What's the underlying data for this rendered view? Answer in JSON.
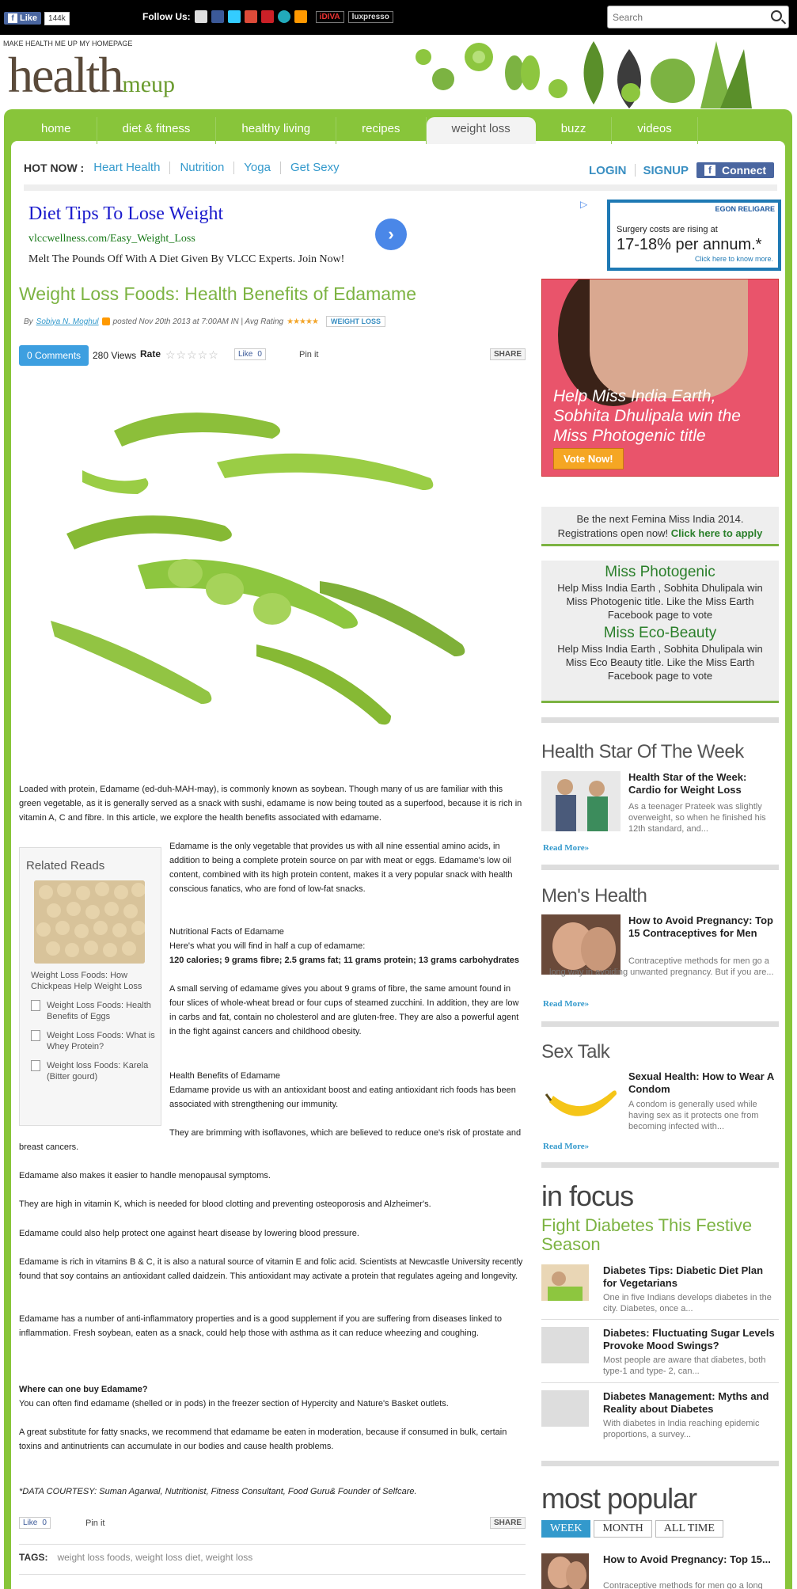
{
  "topbar": {
    "fb_like": "Like",
    "fb_count": "144k",
    "follow_label": "Follow Us:",
    "partner1": "iDIVA",
    "partner2": "luxpresso",
    "search_placeholder": "Search"
  },
  "header": {
    "make_home": "MAKE HEALTH ME UP MY HOMEPAGE",
    "logo_main": "health",
    "logo_sub": "meup"
  },
  "nav": [
    "home",
    "diet & fitness",
    "healthy living",
    "recipes",
    "weight loss",
    "buzz",
    "videos"
  ],
  "hotnow": {
    "label": "HOT NOW :",
    "links": [
      "Heart Health",
      "Nutrition",
      "Yoga",
      "Get Sexy"
    ]
  },
  "auth": {
    "login": "LOGIN",
    "signup": "SIGNUP",
    "connect": "Connect"
  },
  "ad": {
    "title": "Diet Tips To Lose Weight",
    "url": "vlccwellness.com/Easy_Weight_Loss",
    "desc": "Melt The Pounds Off With A Diet Given By VLCC Experts. Join Now!",
    "banner_brand": "EGON RELIGARE",
    "banner_line1": "Surgery costs are rising at",
    "banner_line2": "17-18% per annum.*",
    "banner_line3": "Click here to know more."
  },
  "article": {
    "title": "Weight Loss Foods: Health Benefits of Edamame",
    "by": "By",
    "author": "Sobiya N. Moghul",
    "posted": "posted Nov 20th 2013 at 7:00AM IN | Avg Rating",
    "tag": "WEIGHT LOSS",
    "comments": "0 Comments",
    "views": "280 Views",
    "rate": "Rate",
    "like": "Like",
    "like_count": "0",
    "pinit": "Pin it",
    "share": "SHARE",
    "p1": "Loaded with protein, Edamame (ed-duh-MAH-may), is commonly known as soybean. Though many of us are familiar with this green vegetable, as it is generally served as a snack with sushi, edamame is now being touted as a superfood, because it is rich in vitamin A, C and fibre. In this article, we explore the health benefits associated with edamame.",
    "p2": "Edamame is the only vegetable that provides us with all nine essential amino acids, in addition to being a complete protein source on par with meat or eggs. Edamame's low oil content, combined with its high protein content, makes it a very popular snack with health conscious fanatics, who are fond of low-fat snacks.",
    "h_nutrition": "Nutritional Facts of Edamame",
    "p3": "Here's what you will find in half a cup of edamame:",
    "p4": "120 calories; 9 grams fibre; 2.5 grams fat; 11 grams protein; 13 grams carbohydrates",
    "p5": "A small serving of edamame gives you about 9 grams of fibre, the same amount found in four slices of whole-wheat bread or four cups of steamed zucchini. In addition, they are low in carbs and fat, contain no cholesterol and are gluten-free. They are also a powerful agent in the fight against cancers and childhood obesity.",
    "h_benefits": "Health Benefits of Edamame",
    "p6": "Edamame provide us with an antioxidant boost and eating antioxidant rich foods has been associated with strengthening our immunity.",
    "p7": "They are brimming with isoflavones, which are believed to reduce one's risk of prostate and breast cancers.",
    "p8": "Edamame also makes it easier to handle menopausal symptoms.",
    "p9": "They are high in vitamin K, which is needed for blood clotting and preventing osteoporosis and Alzheimer's.",
    "p10": "Edamame could also help protect one against heart disease by lowering blood pressure.",
    "p11": "Edamame is rich in vitamins B & C, it is also a natural source of vitamin E and folic acid. Scientists at Newcastle University recently found that soy contains an antioxidant called daidzein. This antioxidant may activate a protein that regulates ageing and longevity.",
    "p12": "Edamame has a number of anti-inflammatory properties and is a good supplement if you are suffering from diseases linked to inflammation. Fresh soybean, eaten as a snack, could help those with asthma as it can reduce wheezing and coughing.",
    "h_where": "Where can one buy Edamame?",
    "p13": "You can often find edamame (shelled or in pods) in the freezer section of Hypercity and Nature's Basket outlets.",
    "p14": "A great substitute for fatty snacks, we recommend that edamame be eaten in moderation, because if consumed in bulk, certain toxins and antinutrients can accumulate in our bodies and cause health problems.",
    "courtesy": "*DATA COURTESY: Suman Agarwal, Nutritionist, Fitness Consultant, Food Guru& Founder of Selfcare.",
    "tags_label": "TAGS:",
    "tags": "weight loss foods, weight loss diet, weight loss"
  },
  "related": {
    "title": "Related Reads",
    "main": "Weight Loss Foods: How Chickpeas Help Weight Loss",
    "items": [
      "Weight Loss Foods: Health Benefits of Eggs",
      "Weight Loss Foods: What is Whey Protein?",
      "Weight loss Foods: Karela (Bitter gourd)"
    ]
  },
  "sidebar": {
    "promo_text": "Help Miss India Earth, Sobhita Dhulipala win the Miss Photogenic title",
    "promo_vote": "Vote Now!",
    "femina1": "Be the next Femina Miss India 2014.",
    "femina2": "Registrations open now!",
    "femina_link": "Click here to apply",
    "miss1_title": "Miss Photogenic",
    "miss1_text": "Help Miss India Earth , Sobhita Dhulipala win Miss Photogenic title. Like the Miss Earth Facebook page to vote",
    "miss2_title": "Miss Eco-Beauty",
    "miss2_text": "Help Miss India Earth , Sobhita Dhulipala win Miss Eco Beauty title. Like the Miss Earth Facebook page to vote",
    "star_h": "Health Star Of The Week",
    "star_title": "Health Star of the Week: Cardio for Weight Loss",
    "star_desc": "As a teenager Prateek was slightly overweight, so when he finished his 12th standard, and...",
    "read_more": "Read More»",
    "men_h": "Men's Health",
    "men_title": "How to Avoid Pregnancy: Top 15 Contraceptives for Men",
    "men_desc": "Contraceptive methods for men go a long way in avoiding unwanted pregnancy. But if you are...",
    "sex_h": "Sex Talk",
    "sex_title": "Sexual Health: How to Wear A Condom",
    "sex_desc": "A condom is generally used while having sex as it protects one from becoming infected with...",
    "focus_h": "in focus",
    "focus_sub": "Fight Diabetes This Festive Season",
    "focus_items": [
      {
        "title": "Diabetes Tips: Diabetic Diet Plan for Vegetarians",
        "desc": "One in five Indians develops diabetes in the city. Diabetes, once a..."
      },
      {
        "title": "Diabetes: Fluctuating Sugar Levels Provoke Mood Swings?",
        "desc": "Most people are aware that diabetes, both type-1 and type- 2, can..."
      },
      {
        "title": "Diabetes Management: Myths and Reality about Diabetes",
        "desc": "With diabetes in India reaching epidemic proportions, a survey..."
      }
    ],
    "pop_h": "most popular",
    "pop_tabs": [
      "WEEK",
      "MONTH",
      "ALL TIME"
    ],
    "pop_item": "How to Avoid Pregnancy: Top 15...",
    "pop_desc": "Contraceptive methods for men go a long"
  }
}
